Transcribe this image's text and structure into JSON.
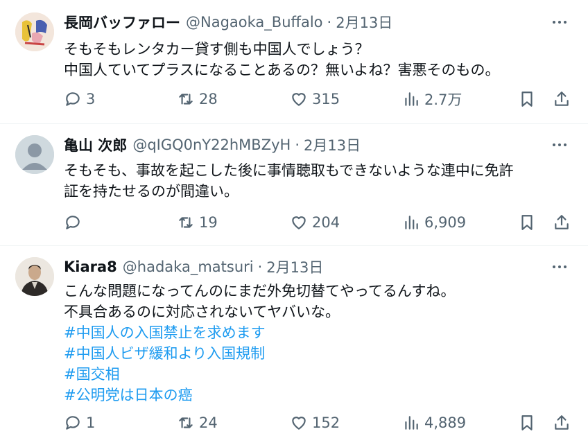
{
  "tweets": [
    {
      "name": "長岡バッファロー",
      "handle": "@Nagaoka_Buffalo",
      "time": "2月13日",
      "lines": [
        "そもそもレンタカー貸す側も中国人でしょう？",
        "中国人ていてプラスになることあるの？無いよね？害悪そのもの。"
      ],
      "hashtags": [],
      "replies": "3",
      "reposts": "28",
      "likes": "315",
      "views": "2.7万"
    },
    {
      "name": "亀山 次郎",
      "handle": "@qIGQ0nY22hMBZyH",
      "time": "2月13日",
      "lines": [
        "そもそも、事故を起こした後に事情聴取もできないような連中に免許",
        "証を持たせるのが間違い。"
      ],
      "hashtags": [],
      "replies": "",
      "reposts": "19",
      "likes": "204",
      "views": "6,909"
    },
    {
      "name": "Kiara8",
      "handle": "@hadaka_matsuri",
      "time": "2月13日",
      "lines": [
        "こんな問題になってんのにまだ外免切替てやってるんすね。",
        "不具合あるのに対応されないてヤバいな。"
      ],
      "hashtags": [
        "#中国人の入国禁止を求めます",
        "#中国人ビザ緩和より入国規制",
        "#国交相",
        "#公明党は日本の癌"
      ],
      "replies": "1",
      "reposts": "24",
      "likes": "152",
      "views": "4,889"
    }
  ],
  "separator": "·",
  "icons": {
    "reply": "reply-bubble-icon",
    "repost": "repost-arrows-icon",
    "like": "heart-icon",
    "views": "bar-chart-icon",
    "bookmark": "bookmark-icon",
    "share": "share-upload-icon",
    "more": "more-dots-icon"
  },
  "colors": {
    "text": "#0f1419",
    "secondary": "#536471",
    "link": "#1d9bf0",
    "divider": "#eff3f4"
  }
}
